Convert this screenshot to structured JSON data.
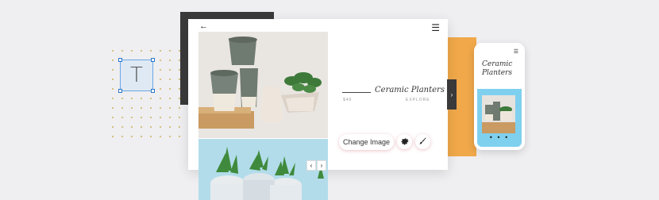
{
  "editor": {
    "text_tool_glyph": "T",
    "next_handle": "›"
  },
  "card": {
    "back": "←",
    "menu": "☰",
    "title": "Ceramic Planters",
    "sub_left": "$46",
    "sub_right": "EXPLORE",
    "change_image": "Change Image",
    "prev": "‹",
    "next": "›"
  },
  "mobile": {
    "menu": "☰",
    "title": "Ceramic Planters",
    "dots": "• • •"
  },
  "icons": {
    "settings": "gear-icon",
    "edit": "brush-icon"
  },
  "colors": {
    "orange": "#f0a84a",
    "dark": "#3a3a3a",
    "sky": "#7fd0ef",
    "selection": "#2b76c9"
  }
}
